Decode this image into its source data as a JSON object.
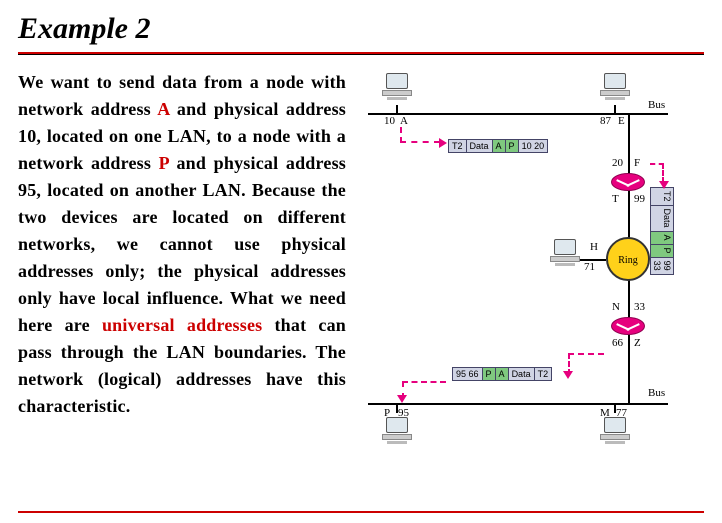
{
  "title": "Example 2",
  "paragraph": {
    "t1": "We want to send data from a node with network address ",
    "addrA": "A",
    "t2": " and physical address 10, located on one LAN, to a node with a network address ",
    "addrP": "P",
    "t3": " and physical address 95, located on another LAN. Because the two devices are located on different networks, we cannot use physical addresses only; the physical addresses only have local influence. What we need here are ",
    "univ": "universal addresses",
    "t4": " that can pass through the LAN boundaries. The network (logical) addresses have this characteristic."
  },
  "nodes": {
    "a": {
      "phys": "10",
      "net": "A"
    },
    "e": {
      "phys": "87",
      "net": "E"
    },
    "f": {
      "phys": "20",
      "net": "F"
    },
    "t": {
      "label": "T",
      "port": "99"
    },
    "h": {
      "phys": "71",
      "net": "H"
    },
    "n": {
      "label": "N",
      "port": "33"
    },
    "z": {
      "phys": "66",
      "net": "Z"
    },
    "m": {
      "phys": "77",
      "net": "M"
    },
    "p": {
      "phys": "95",
      "net": "P"
    }
  },
  "bus_top": "Bus",
  "bus_bot": "Bus",
  "ring": "Ring",
  "packet_top": {
    "c1": "T2",
    "c2": "Data",
    "c3": "A",
    "c4": "P",
    "c5": "10 20"
  },
  "packet_right": {
    "c1": "T2",
    "c2": "Data",
    "c3": "A",
    "c4": "P",
    "c5": "99 33"
  },
  "packet_bot": {
    "c1": "95 66",
    "c2": "P",
    "c3": "A",
    "c4": "Data",
    "c5": "T2"
  }
}
